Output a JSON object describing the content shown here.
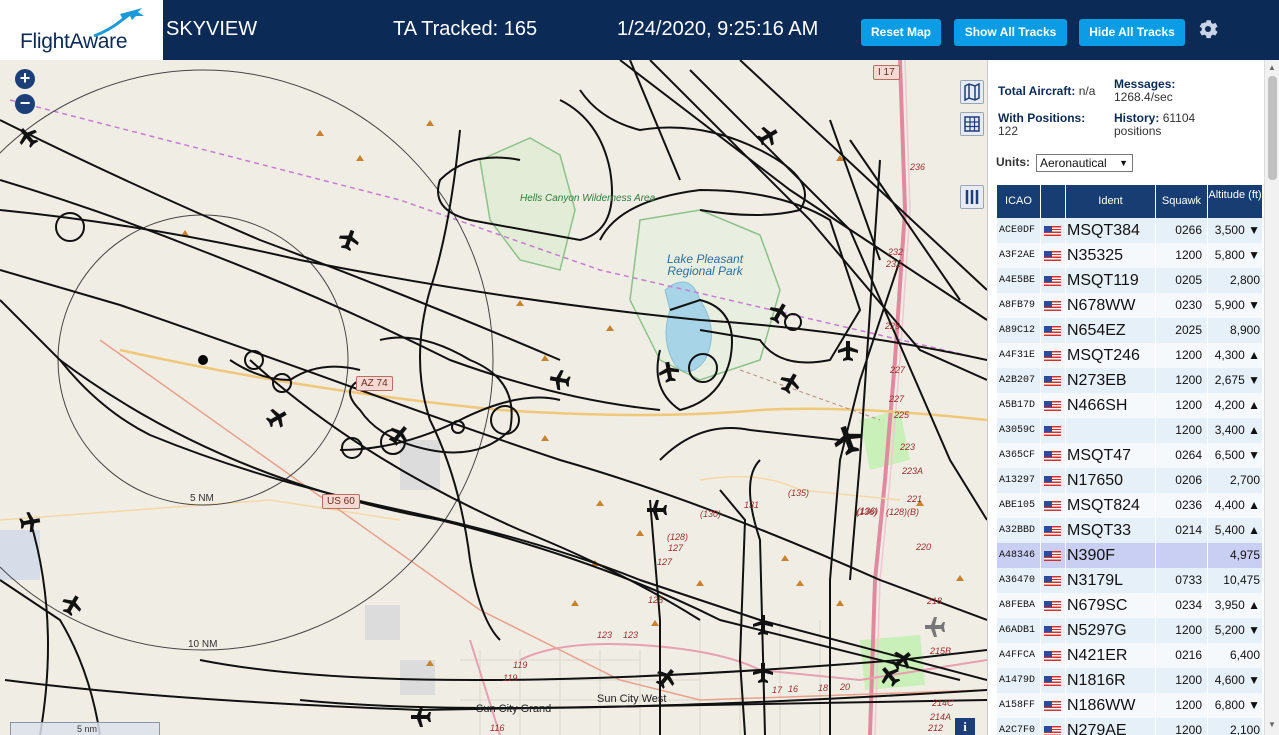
{
  "header": {
    "logo_text": "FlightAware",
    "station": "SKYVIEW",
    "tracked_label": "TA Tracked: 165",
    "clock": "1/24/2020, 9:25:16 AM",
    "buttons": {
      "reset": "Reset Map",
      "show_all": "Show All Tracks",
      "hide_all": "Hide All Tracks"
    }
  },
  "map": {
    "zoom_in": "+",
    "zoom_out": "−",
    "labels": {
      "hells_canyon": "Hells Canyon Wilderness Area",
      "lake_pleasant": "Lake Pleasant Regional Park",
      "sun_city_grand": "Sun City Grand",
      "sun_city_west": "Sun City West",
      "ring_5": "5 NM",
      "ring_10": "10 NM",
      "az74": "AZ 74",
      "us60": "US 60",
      "i17": "I 17",
      "scale": "5 nm",
      "info": "i"
    },
    "route_numbers": [
      "236",
      "232",
      "232",
      "229",
      "227",
      "227",
      "225",
      "223",
      "223A",
      "221",
      "220",
      "218",
      "215B",
      "214C",
      "214A",
      "212",
      "131",
      "(135)",
      "(130)",
      "(136)",
      "(128)",
      "127",
      "127",
      "125",
      "123",
      "123",
      "119",
      "119",
      "116",
      "(136)",
      "(128)(B)",
      "17",
      "16",
      "18",
      "20"
    ]
  },
  "sidebar": {
    "total_aircraft_label": "Total Aircraft:",
    "total_aircraft_value": "n/a",
    "messages_label": "Messages:",
    "messages_value": "1268.4/sec",
    "with_positions_label": "With Positions:",
    "with_positions_value": "122",
    "history_label": "History:",
    "history_value": "61104 positions",
    "units_label": "Units:",
    "units_value": "Aeronautical",
    "columns": {
      "icao": "ICAO",
      "ident": "Ident",
      "squawk": "Squawk",
      "altitude": "Altitude (ft)"
    },
    "rows": [
      {
        "icao": "ACE0DF",
        "ident": "MSQT384",
        "squawk": "0266",
        "altitude": "3,500 ▼"
      },
      {
        "icao": "A3F2AE",
        "ident": "N35325",
        "squawk": "1200",
        "altitude": "5,800 ▼"
      },
      {
        "icao": "A4E5BE",
        "ident": "MSQT119",
        "squawk": "0205",
        "altitude": "2,800"
      },
      {
        "icao": "A8FB79",
        "ident": "N678WW",
        "squawk": "0230",
        "altitude": "5,900 ▼"
      },
      {
        "icao": "A89C12",
        "ident": "N654EZ",
        "squawk": "2025",
        "altitude": "8,900"
      },
      {
        "icao": "A4F31E",
        "ident": "MSQT246",
        "squawk": "1200",
        "altitude": "4,300 ▲"
      },
      {
        "icao": "A2B207",
        "ident": "N273EB",
        "squawk": "1200",
        "altitude": "2,675 ▼"
      },
      {
        "icao": "A5B17D",
        "ident": "N466SH",
        "squawk": "1200",
        "altitude": "4,200 ▲"
      },
      {
        "icao": "A3059C",
        "ident": "",
        "squawk": "1200",
        "altitude": "3,400 ▲"
      },
      {
        "icao": "A365CF",
        "ident": "MSQT47",
        "squawk": "0264",
        "altitude": "6,500 ▼"
      },
      {
        "icao": "A13297",
        "ident": "N17650",
        "squawk": "0206",
        "altitude": "2,700"
      },
      {
        "icao": "ABE105",
        "ident": "MSQT824",
        "squawk": "0236",
        "altitude": "4,400 ▲"
      },
      {
        "icao": "A32BBD",
        "ident": "MSQT33",
        "squawk": "0214",
        "altitude": "5,400 ▲"
      },
      {
        "icao": "A48346",
        "ident": "N390F",
        "squawk": "",
        "altitude": "4,975"
      },
      {
        "icao": "A36470",
        "ident": "N3179L",
        "squawk": "0733",
        "altitude": "10,475"
      },
      {
        "icao": "A8FEBA",
        "ident": "N679SC",
        "squawk": "0234",
        "altitude": "3,950 ▲"
      },
      {
        "icao": "A6ADB1",
        "ident": "N5297G",
        "squawk": "1200",
        "altitude": "5,200 ▼"
      },
      {
        "icao": "A4FFCA",
        "ident": "N421ER",
        "squawk": "0216",
        "altitude": "6,400"
      },
      {
        "icao": "A1479D",
        "ident": "N1816R",
        "squawk": "1200",
        "altitude": "4,600 ▼"
      },
      {
        "icao": "A158FF",
        "ident": "N186WW",
        "squawk": "1200",
        "altitude": "6,800 ▼"
      },
      {
        "icao": "A2C7F0",
        "ident": "N279AE",
        "squawk": "1200",
        "altitude": "2,100"
      }
    ],
    "selected_icao": "A48346"
  },
  "colors": {
    "header_bg": "#0b2a55",
    "button_bg": "#0a9de6",
    "table_header": "#173d73",
    "selected_row": "#c9cff3",
    "map_bg": "#f0ede5"
  },
  "icons": {
    "gear": "gear-icon",
    "layers": "map-layers-icon",
    "grid": "grid-icon",
    "columns": "columns-icon",
    "aircraft": "airplane-icon"
  }
}
